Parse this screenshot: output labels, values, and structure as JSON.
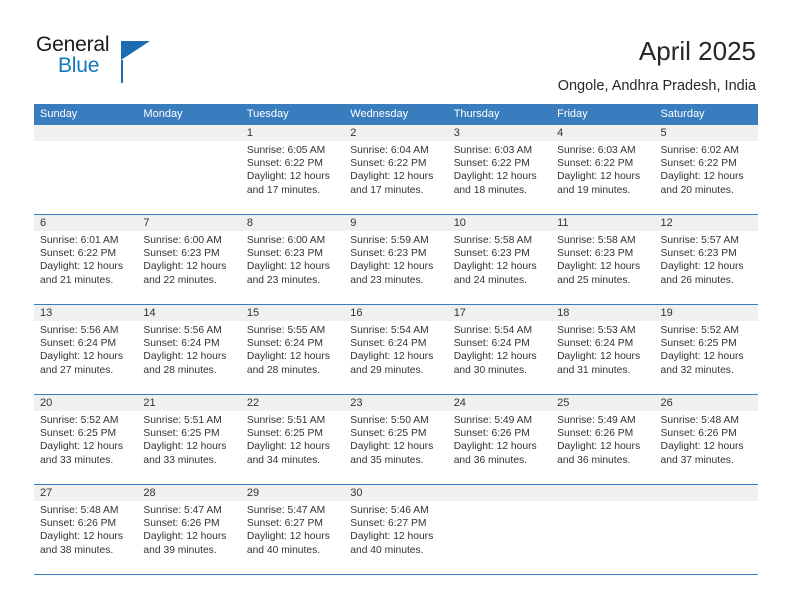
{
  "brand": {
    "name_part1": "General",
    "name_part2": "Blue",
    "accent_color": "#1b6cb0",
    "triangle_icon": "triangle-icon"
  },
  "header": {
    "title": "April 2025",
    "subtitle": "Ongole, Andhra Pradesh, India"
  },
  "calendar": {
    "header_bg": "#3a7dbf",
    "daynum_bg": "#f0f0f0",
    "weekdays": [
      "Sunday",
      "Monday",
      "Tuesday",
      "Wednesday",
      "Thursday",
      "Friday",
      "Saturday"
    ],
    "weeks": [
      [
        {
          "day": "",
          "sunrise": "",
          "sunset": "",
          "daylight_line1": "",
          "daylight_line2": ""
        },
        {
          "day": "",
          "sunrise": "",
          "sunset": "",
          "daylight_line1": "",
          "daylight_line2": ""
        },
        {
          "day": "1",
          "sunrise": "Sunrise: 6:05 AM",
          "sunset": "Sunset: 6:22 PM",
          "daylight_line1": "Daylight: 12 hours",
          "daylight_line2": "and 17 minutes."
        },
        {
          "day": "2",
          "sunrise": "Sunrise: 6:04 AM",
          "sunset": "Sunset: 6:22 PM",
          "daylight_line1": "Daylight: 12 hours",
          "daylight_line2": "and 17 minutes."
        },
        {
          "day": "3",
          "sunrise": "Sunrise: 6:03 AM",
          "sunset": "Sunset: 6:22 PM",
          "daylight_line1": "Daylight: 12 hours",
          "daylight_line2": "and 18 minutes."
        },
        {
          "day": "4",
          "sunrise": "Sunrise: 6:03 AM",
          "sunset": "Sunset: 6:22 PM",
          "daylight_line1": "Daylight: 12 hours",
          "daylight_line2": "and 19 minutes."
        },
        {
          "day": "5",
          "sunrise": "Sunrise: 6:02 AM",
          "sunset": "Sunset: 6:22 PM",
          "daylight_line1": "Daylight: 12 hours",
          "daylight_line2": "and 20 minutes."
        }
      ],
      [
        {
          "day": "6",
          "sunrise": "Sunrise: 6:01 AM",
          "sunset": "Sunset: 6:22 PM",
          "daylight_line1": "Daylight: 12 hours",
          "daylight_line2": "and 21 minutes."
        },
        {
          "day": "7",
          "sunrise": "Sunrise: 6:00 AM",
          "sunset": "Sunset: 6:23 PM",
          "daylight_line1": "Daylight: 12 hours",
          "daylight_line2": "and 22 minutes."
        },
        {
          "day": "8",
          "sunrise": "Sunrise: 6:00 AM",
          "sunset": "Sunset: 6:23 PM",
          "daylight_line1": "Daylight: 12 hours",
          "daylight_line2": "and 23 minutes."
        },
        {
          "day": "9",
          "sunrise": "Sunrise: 5:59 AM",
          "sunset": "Sunset: 6:23 PM",
          "daylight_line1": "Daylight: 12 hours",
          "daylight_line2": "and 23 minutes."
        },
        {
          "day": "10",
          "sunrise": "Sunrise: 5:58 AM",
          "sunset": "Sunset: 6:23 PM",
          "daylight_line1": "Daylight: 12 hours",
          "daylight_line2": "and 24 minutes."
        },
        {
          "day": "11",
          "sunrise": "Sunrise: 5:58 AM",
          "sunset": "Sunset: 6:23 PM",
          "daylight_line1": "Daylight: 12 hours",
          "daylight_line2": "and 25 minutes."
        },
        {
          "day": "12",
          "sunrise": "Sunrise: 5:57 AM",
          "sunset": "Sunset: 6:23 PM",
          "daylight_line1": "Daylight: 12 hours",
          "daylight_line2": "and 26 minutes."
        }
      ],
      [
        {
          "day": "13",
          "sunrise": "Sunrise: 5:56 AM",
          "sunset": "Sunset: 6:24 PM",
          "daylight_line1": "Daylight: 12 hours",
          "daylight_line2": "and 27 minutes."
        },
        {
          "day": "14",
          "sunrise": "Sunrise: 5:56 AM",
          "sunset": "Sunset: 6:24 PM",
          "daylight_line1": "Daylight: 12 hours",
          "daylight_line2": "and 28 minutes."
        },
        {
          "day": "15",
          "sunrise": "Sunrise: 5:55 AM",
          "sunset": "Sunset: 6:24 PM",
          "daylight_line1": "Daylight: 12 hours",
          "daylight_line2": "and 28 minutes."
        },
        {
          "day": "16",
          "sunrise": "Sunrise: 5:54 AM",
          "sunset": "Sunset: 6:24 PM",
          "daylight_line1": "Daylight: 12 hours",
          "daylight_line2": "and 29 minutes."
        },
        {
          "day": "17",
          "sunrise": "Sunrise: 5:54 AM",
          "sunset": "Sunset: 6:24 PM",
          "daylight_line1": "Daylight: 12 hours",
          "daylight_line2": "and 30 minutes."
        },
        {
          "day": "18",
          "sunrise": "Sunrise: 5:53 AM",
          "sunset": "Sunset: 6:24 PM",
          "daylight_line1": "Daylight: 12 hours",
          "daylight_line2": "and 31 minutes."
        },
        {
          "day": "19",
          "sunrise": "Sunrise: 5:52 AM",
          "sunset": "Sunset: 6:25 PM",
          "daylight_line1": "Daylight: 12 hours",
          "daylight_line2": "and 32 minutes."
        }
      ],
      [
        {
          "day": "20",
          "sunrise": "Sunrise: 5:52 AM",
          "sunset": "Sunset: 6:25 PM",
          "daylight_line1": "Daylight: 12 hours",
          "daylight_line2": "and 33 minutes."
        },
        {
          "day": "21",
          "sunrise": "Sunrise: 5:51 AM",
          "sunset": "Sunset: 6:25 PM",
          "daylight_line1": "Daylight: 12 hours",
          "daylight_line2": "and 33 minutes."
        },
        {
          "day": "22",
          "sunrise": "Sunrise: 5:51 AM",
          "sunset": "Sunset: 6:25 PM",
          "daylight_line1": "Daylight: 12 hours",
          "daylight_line2": "and 34 minutes."
        },
        {
          "day": "23",
          "sunrise": "Sunrise: 5:50 AM",
          "sunset": "Sunset: 6:25 PM",
          "daylight_line1": "Daylight: 12 hours",
          "daylight_line2": "and 35 minutes."
        },
        {
          "day": "24",
          "sunrise": "Sunrise: 5:49 AM",
          "sunset": "Sunset: 6:26 PM",
          "daylight_line1": "Daylight: 12 hours",
          "daylight_line2": "and 36 minutes."
        },
        {
          "day": "25",
          "sunrise": "Sunrise: 5:49 AM",
          "sunset": "Sunset: 6:26 PM",
          "daylight_line1": "Daylight: 12 hours",
          "daylight_line2": "and 36 minutes."
        },
        {
          "day": "26",
          "sunrise": "Sunrise: 5:48 AM",
          "sunset": "Sunset: 6:26 PM",
          "daylight_line1": "Daylight: 12 hours",
          "daylight_line2": "and 37 minutes."
        }
      ],
      [
        {
          "day": "27",
          "sunrise": "Sunrise: 5:48 AM",
          "sunset": "Sunset: 6:26 PM",
          "daylight_line1": "Daylight: 12 hours",
          "daylight_line2": "and 38 minutes."
        },
        {
          "day": "28",
          "sunrise": "Sunrise: 5:47 AM",
          "sunset": "Sunset: 6:26 PM",
          "daylight_line1": "Daylight: 12 hours",
          "daylight_line2": "and 39 minutes."
        },
        {
          "day": "29",
          "sunrise": "Sunrise: 5:47 AM",
          "sunset": "Sunset: 6:27 PM",
          "daylight_line1": "Daylight: 12 hours",
          "daylight_line2": "and 40 minutes."
        },
        {
          "day": "30",
          "sunrise": "Sunrise: 5:46 AM",
          "sunset": "Sunset: 6:27 PM",
          "daylight_line1": "Daylight: 12 hours",
          "daylight_line2": "and 40 minutes."
        },
        {
          "day": "",
          "sunrise": "",
          "sunset": "",
          "daylight_line1": "",
          "daylight_line2": ""
        },
        {
          "day": "",
          "sunrise": "",
          "sunset": "",
          "daylight_line1": "",
          "daylight_line2": ""
        },
        {
          "day": "",
          "sunrise": "",
          "sunset": "",
          "daylight_line1": "",
          "daylight_line2": ""
        }
      ]
    ]
  }
}
